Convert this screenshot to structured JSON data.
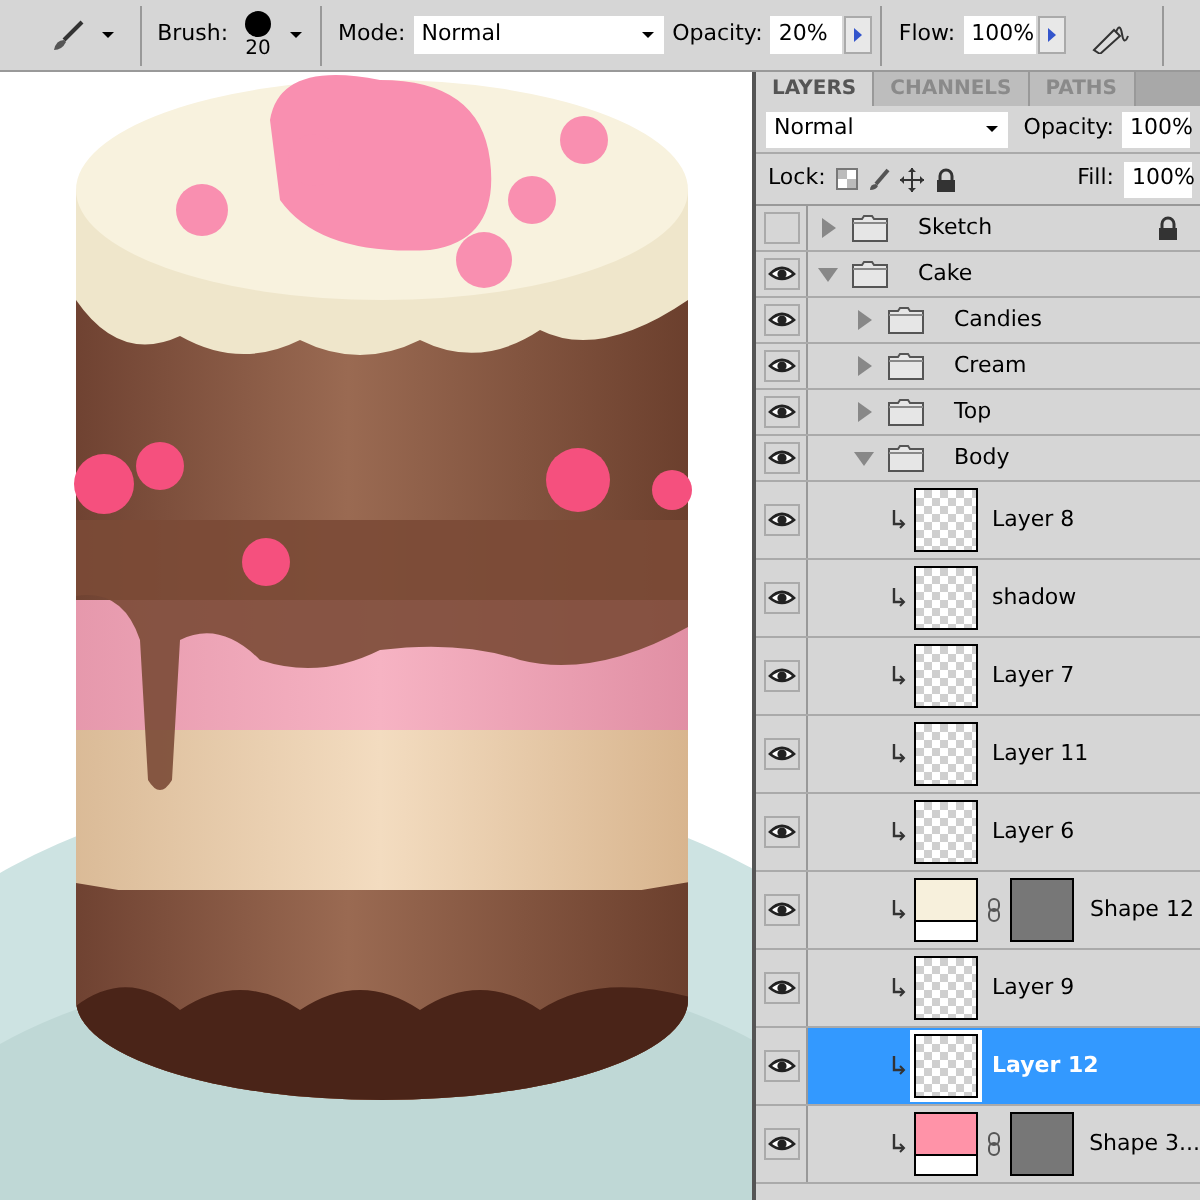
{
  "toolbar": {
    "brush_label": "Brush:",
    "brush_size": "20",
    "mode_label": "Mode:",
    "mode": "Normal",
    "opacity_label": "Opacity:",
    "opacity": "20%",
    "flow_label": "Flow:",
    "flow": "100%"
  },
  "panel": {
    "tabs": [
      {
        "label": "LAYERS",
        "selected": true
      },
      {
        "label": "CHANNELS",
        "selected": false
      },
      {
        "label": "PATHS",
        "selected": false
      }
    ],
    "blend_mode": "Normal",
    "opacity_label": "Opacity:",
    "opacity": "100%",
    "lock_label": "Lock:",
    "fill_label": "Fill:",
    "fill": "100%",
    "layers": [
      {
        "kind": "group",
        "name": "Sketch",
        "visible": false,
        "locked": true,
        "expanded": false,
        "selected": false
      },
      {
        "kind": "group",
        "name": "Cake",
        "visible": true,
        "expanded": true,
        "selected": false,
        "children": [
          {
            "kind": "group",
            "name": "Candies",
            "visible": true,
            "expanded": false,
            "selected": false
          },
          {
            "kind": "group",
            "name": "Cream",
            "visible": true,
            "expanded": false,
            "selected": false
          },
          {
            "kind": "group",
            "name": "Top",
            "visible": true,
            "expanded": false,
            "selected": false
          },
          {
            "kind": "group",
            "name": "Body",
            "visible": true,
            "expanded": true,
            "selected": false,
            "children": [
              {
                "kind": "layer",
                "name": "Layer 8",
                "visible": true,
                "selected": false
              },
              {
                "kind": "layer",
                "name": "shadow",
                "visible": true,
                "selected": false
              },
              {
                "kind": "layer",
                "name": "Layer 7",
                "visible": true,
                "selected": false
              },
              {
                "kind": "layer",
                "name": "Layer 11",
                "visible": true,
                "selected": false
              },
              {
                "kind": "layer",
                "name": "Layer 6",
                "visible": true,
                "selected": false
              },
              {
                "kind": "shape",
                "name": "Shape 12",
                "visible": true,
                "selected": false,
                "color": "#f7f0dc"
              },
              {
                "kind": "layer",
                "name": "Layer 9",
                "visible": true,
                "selected": false
              },
              {
                "kind": "layer",
                "name": "Layer 12",
                "visible": true,
                "selected": true
              },
              {
                "kind": "shape",
                "name": "Shape 3...",
                "visible": true,
                "selected": false,
                "color": "#ff93a8"
              }
            ]
          }
        ]
      }
    ]
  }
}
